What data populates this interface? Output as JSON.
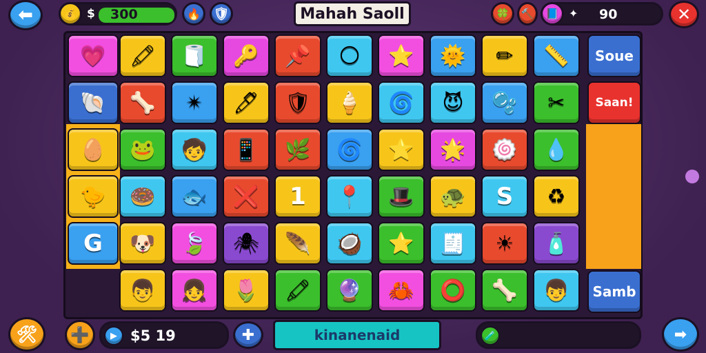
{
  "title": "Mahah Saoll",
  "top_left": {
    "coins_symbol": "$",
    "coins_value": "300"
  },
  "top_right": {
    "score_value": "90"
  },
  "side_buttons": {
    "right_top": "Soue",
    "right_second": "Saan!",
    "right_bottom": "Samb",
    "left_g": "G"
  },
  "bottom_bar": {
    "money_value": "$5 19",
    "name_text": "kinanenaid"
  },
  "colors": {
    "accent_blue": "#3aa0f0",
    "close_red": "#e8322e",
    "bar_green": "#3bbf2c"
  },
  "grid": [
    [
      {
        "c": "#f24fe0",
        "i": "💗"
      },
      {
        "c": "#f7c51a",
        "i": "🖍"
      },
      {
        "c": "#3bbf2c",
        "i": "🧻"
      },
      {
        "c": "#e649e0",
        "i": "🔑"
      },
      {
        "c": "#e84a2e",
        "i": "📌"
      },
      {
        "c": "#3fc7f0",
        "i": "🌕"
      },
      {
        "c": "#f24fe0",
        "i": "⭐"
      },
      {
        "c": "#3aa0f0",
        "i": "🌞"
      },
      {
        "c": "#f7c51a",
        "i": "✏"
      },
      {
        "c": "#3aa0f0",
        "i": "📏"
      }
    ],
    [
      {
        "c": "#3a6fd0",
        "i": "🐚"
      },
      {
        "c": "#e84a2e",
        "i": "🦴"
      },
      {
        "c": "#3aa0f0",
        "i": "✴"
      },
      {
        "c": "#f7c51a",
        "i": "🖊"
      },
      {
        "c": "#e84a2e",
        "i": "🛡"
      },
      {
        "c": "#f7c51a",
        "i": "🍦"
      },
      {
        "c": "#3fc7f0",
        "i": "🌀"
      },
      {
        "c": "#3fc7f0",
        "i": "😈"
      },
      {
        "c": "#3aa0f0",
        "i": "🫧"
      },
      {
        "c": "#3bbf2c",
        "i": "✂"
      }
    ],
    [
      {
        "c": "#f7c51a",
        "i": "🥚"
      },
      {
        "c": "#3bbf2c",
        "i": "🐸"
      },
      {
        "c": "#3fc7f0",
        "i": "🧒"
      },
      {
        "c": "#e84a2e",
        "i": "📱"
      },
      {
        "c": "#e84a2e",
        "i": "🌿"
      },
      {
        "c": "#3aa0f0",
        "i": "🌀"
      },
      {
        "c": "#f7c51a",
        "i": "⭐"
      },
      {
        "c": "#e649e0",
        "i": "🌟"
      },
      {
        "c": "#e84a2e",
        "i": "🍥"
      },
      {
        "c": "#3bbf2c",
        "i": "💧"
      }
    ],
    [
      {
        "c": "#f7c51a",
        "i": "🐤"
      },
      {
        "c": "#3fc7f0",
        "i": "🍩"
      },
      {
        "c": "#3aa0f0",
        "i": "🐟"
      },
      {
        "c": "#e84a2e",
        "i": "❌"
      },
      {
        "c": "#f7c51a",
        "i": "1"
      },
      {
        "c": "#3fc7f0",
        "i": "📍"
      },
      {
        "c": "#3bbf2c",
        "i": "🎩"
      },
      {
        "c": "#f7c51a",
        "i": "🐢"
      },
      {
        "c": "#3fc7f0",
        "i": "S"
      },
      {
        "c": "#f7c51a",
        "i": "♻"
      }
    ],
    [
      {
        "c": "#3aa0f0",
        "i": "G"
      },
      {
        "c": "#f7c51a",
        "i": "🐶"
      },
      {
        "c": "#f24fe0",
        "i": "🍃"
      },
      {
        "c": "#8a4ad0",
        "i": "🕷"
      },
      {
        "c": "#f7c51a",
        "i": "🪶"
      },
      {
        "c": "#3fc7f0",
        "i": "🥥"
      },
      {
        "c": "#3bbf2c",
        "i": "⭐"
      },
      {
        "c": "#3fc7f0",
        "i": "🧾"
      },
      {
        "c": "#e84a2e",
        "i": "☀"
      },
      {
        "c": "#8a4ad0",
        "i": "🧴"
      }
    ],
    [
      {
        "c": "#2a1836",
        "i": ""
      },
      {
        "c": "#f7c51a",
        "i": "👦"
      },
      {
        "c": "#f24fe0",
        "i": "👧"
      },
      {
        "c": "#f7c51a",
        "i": "🌷"
      },
      {
        "c": "#3bbf2c",
        "i": "🖍"
      },
      {
        "c": "#3bbf2c",
        "i": "🔮"
      },
      {
        "c": "#f24fe0",
        "i": "🦀"
      },
      {
        "c": "#3bbf2c",
        "i": "⭕"
      },
      {
        "c": "#3bbf2c",
        "i": "🦴"
      },
      {
        "c": "#3fc7f0",
        "i": "👦"
      }
    ]
  ]
}
